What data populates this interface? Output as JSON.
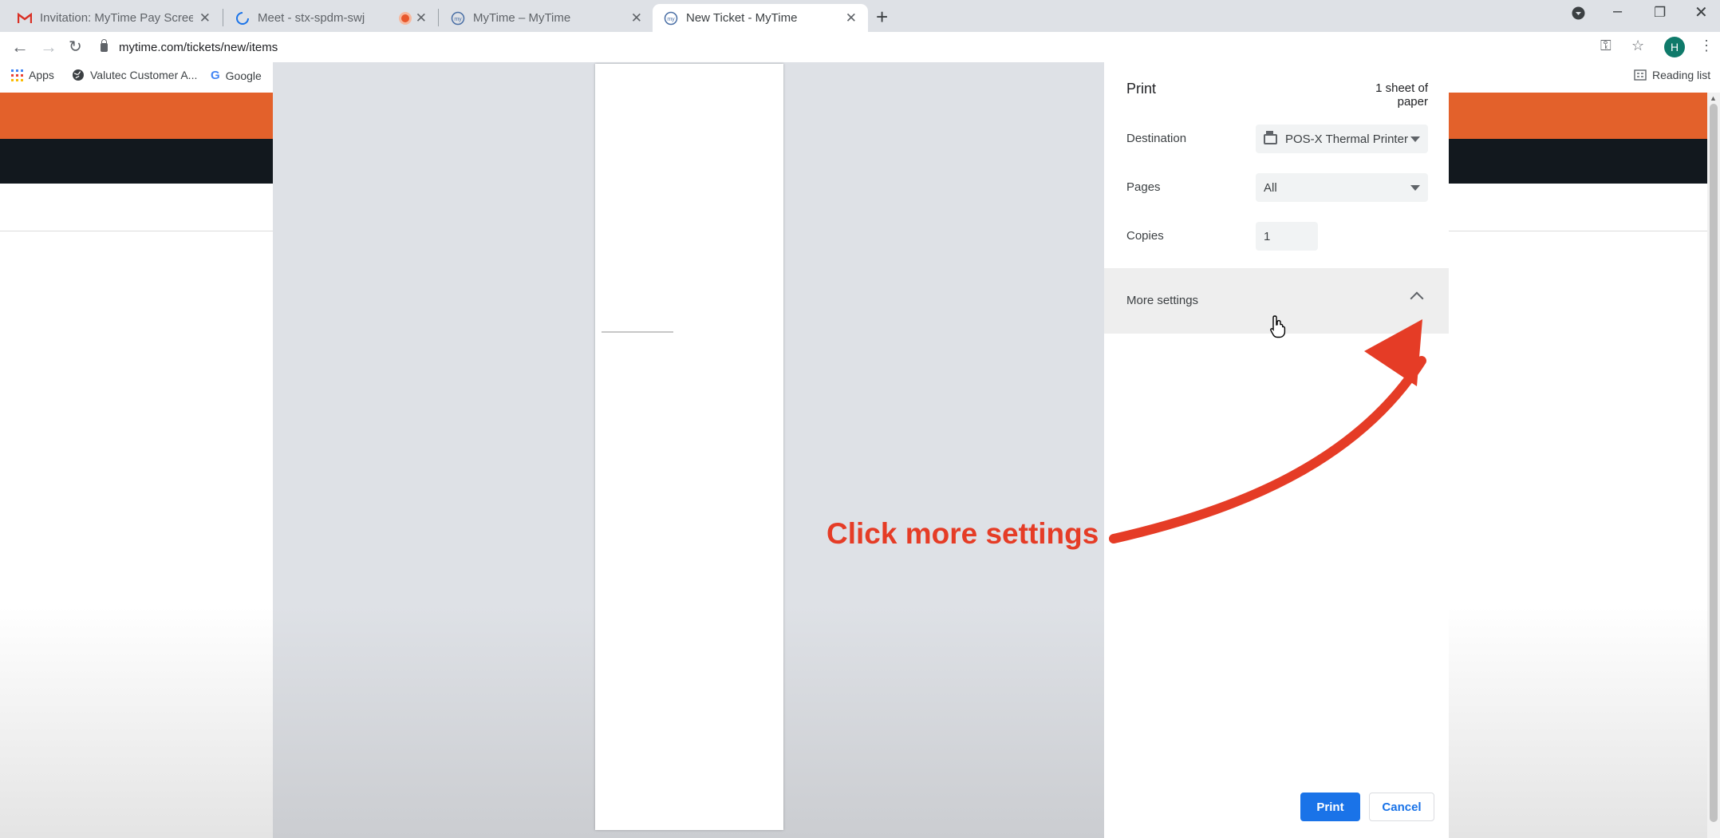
{
  "browser": {
    "tabs": [
      {
        "label": "Invitation: MyTime Pay Screensh",
        "favicon": "gmail-icon"
      },
      {
        "label": "Meet - stx-spdm-swj",
        "favicon": "loading-icon"
      },
      {
        "label": "MyTime – MyTime",
        "favicon": "mytime-icon"
      },
      {
        "label": "New Ticket - MyTime",
        "favicon": "mytime-icon",
        "active": true
      }
    ],
    "url": "mytime.com/tickets/new/items",
    "bookmarks": [
      {
        "label": "Apps",
        "icon": "apps-grid-icon"
      },
      {
        "label": "Valutec Customer A...",
        "icon": "globe-icon"
      },
      {
        "label": "Google",
        "icon": "google-icon"
      }
    ],
    "reading_list": "Reading list",
    "profile_initial": "H"
  },
  "print_dialog": {
    "title": "Print",
    "sheet_count": "1 sheet of paper",
    "destination_label": "Destination",
    "destination_value": "POS-X Thermal Printer",
    "pages_label": "Pages",
    "pages_value": "All",
    "copies_label": "Copies",
    "copies_value": "1",
    "more_settings_label": "More settings",
    "print_button": "Print",
    "cancel_button": "Cancel"
  },
  "annotation": {
    "text": "Click more settings",
    "color": "#e53c26"
  },
  "colors": {
    "page_header": "#e3612b",
    "page_nav": "#12181e",
    "accent": "#1a73e8"
  }
}
